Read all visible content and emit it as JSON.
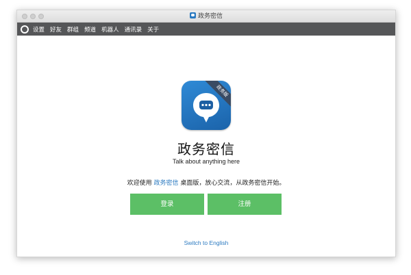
{
  "window": {
    "title": "政务密信"
  },
  "menubar": {
    "items": [
      {
        "label": "设置"
      },
      {
        "label": "好友"
      },
      {
        "label": "群组"
      },
      {
        "label": "频道"
      },
      {
        "label": "机器人"
      },
      {
        "label": "通讯录"
      },
      {
        "label": "关于"
      }
    ]
  },
  "main": {
    "icon_badge": "政务版",
    "app_name": "政务密信",
    "tagline": "Talk about anything here",
    "welcome_prefix": "欢迎使用 ",
    "welcome_brand": "政务密信",
    "welcome_suffix": " 桌面版，放心交流，从政务密信开始。",
    "login_label": "登录",
    "register_label": "注册",
    "switch_language": "Switch to English"
  },
  "colors": {
    "menubar_bg": "#555658",
    "accent_blue": "#2a79c0",
    "button_green": "#5cbf66",
    "icon_blue": "#1b63aa"
  }
}
